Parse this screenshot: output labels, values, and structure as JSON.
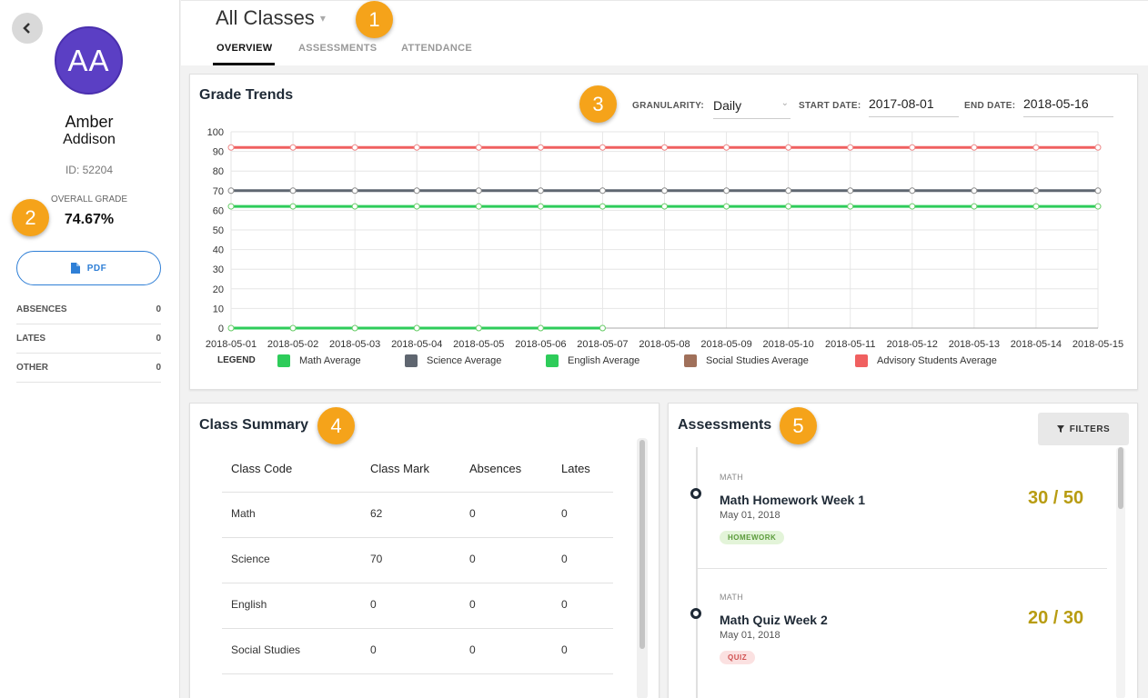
{
  "student": {
    "initials": "AA",
    "first_name": "Amber",
    "last_name": "Addison",
    "id_text": "ID: 52204",
    "overall_grade_label": "OVERALL GRADE",
    "overall_grade": "74.67%",
    "pdf_label": "PDF",
    "stats": [
      {
        "label": "ABSENCES",
        "value": "0"
      },
      {
        "label": "LATES",
        "value": "0"
      },
      {
        "label": "OTHER",
        "value": "0"
      }
    ]
  },
  "badges": [
    "1",
    "2",
    "3",
    "4",
    "5"
  ],
  "header": {
    "class_select": "All Classes",
    "tabs": [
      {
        "label": "OVERVIEW",
        "active": true
      },
      {
        "label": "ASSESSMENTS",
        "active": false
      },
      {
        "label": "ATTENDANCE",
        "active": false
      }
    ]
  },
  "grade_trends": {
    "title": "Grade Trends",
    "granularity_label": "GRANULARITY:",
    "granularity_value": "Daily",
    "start_label": "START DATE:",
    "start_value": "2017-08-01",
    "end_label": "END DATE:",
    "end_value": "2018-05-16",
    "legend_label": "LEGEND"
  },
  "chart_data": {
    "type": "line",
    "x": [
      "2018-05-01",
      "2018-05-02",
      "2018-05-03",
      "2018-05-04",
      "2018-05-05",
      "2018-05-06",
      "2018-05-07",
      "2018-05-08",
      "2018-05-09",
      "2018-05-10",
      "2018-05-11",
      "2018-05-12",
      "2018-05-13",
      "2018-05-14",
      "2018-05-15"
    ],
    "ylim": [
      0,
      100
    ],
    "yticks": [
      0,
      10,
      20,
      30,
      40,
      50,
      60,
      70,
      80,
      90,
      100
    ],
    "grid": true,
    "legend_position": "bottom",
    "series": [
      {
        "name": "Math Average",
        "color": "#2ecc5a",
        "values": [
          62,
          62,
          62,
          62,
          62,
          62,
          62,
          62,
          62,
          62,
          62,
          62,
          62,
          62,
          62
        ]
      },
      {
        "name": "Science Average",
        "color": "#5f6670",
        "values": [
          70,
          70,
          70,
          70,
          70,
          70,
          70,
          70,
          70,
          70,
          70,
          70,
          70,
          70,
          70
        ]
      },
      {
        "name": "English Average",
        "color": "#2ecc5a",
        "values": [
          0,
          0,
          0,
          0,
          0,
          0,
          0,
          null,
          null,
          null,
          null,
          null,
          null,
          null,
          null
        ]
      },
      {
        "name": "Social Studies Average",
        "color": "#a0705a",
        "values": []
      },
      {
        "name": "Advisory Students Average",
        "color": "#f06060",
        "values": [
          92,
          92,
          92,
          92,
          92,
          92,
          92,
          92,
          92,
          92,
          92,
          92,
          92,
          92,
          92
        ]
      }
    ]
  },
  "class_summary": {
    "title": "Class Summary",
    "headers": [
      "Class Code",
      "Class Mark",
      "Absences",
      "Lates"
    ],
    "rows": [
      [
        "Math",
        "62",
        "0",
        "0"
      ],
      [
        "Science",
        "70",
        "0",
        "0"
      ],
      [
        "English",
        "0",
        "0",
        "0"
      ],
      [
        "Social Studies",
        "0",
        "0",
        "0"
      ]
    ]
  },
  "assessments": {
    "title": "Assessments",
    "filters_label": "FILTERS",
    "items": [
      {
        "subject": "MATH",
        "title": "Math Homework Week 1",
        "date": "May 01, 2018",
        "tag": "HOMEWORK",
        "tag_color": "#e3f4d9",
        "tag_text_color": "#5a9a3a",
        "score": "30 / 50"
      },
      {
        "subject": "MATH",
        "title": "Math Quiz Week 2",
        "date": "May 01, 2018",
        "tag": "QUIZ",
        "tag_color": "#fbe1e1",
        "tag_text_color": "#d05050",
        "score": "20 / 30"
      }
    ]
  }
}
